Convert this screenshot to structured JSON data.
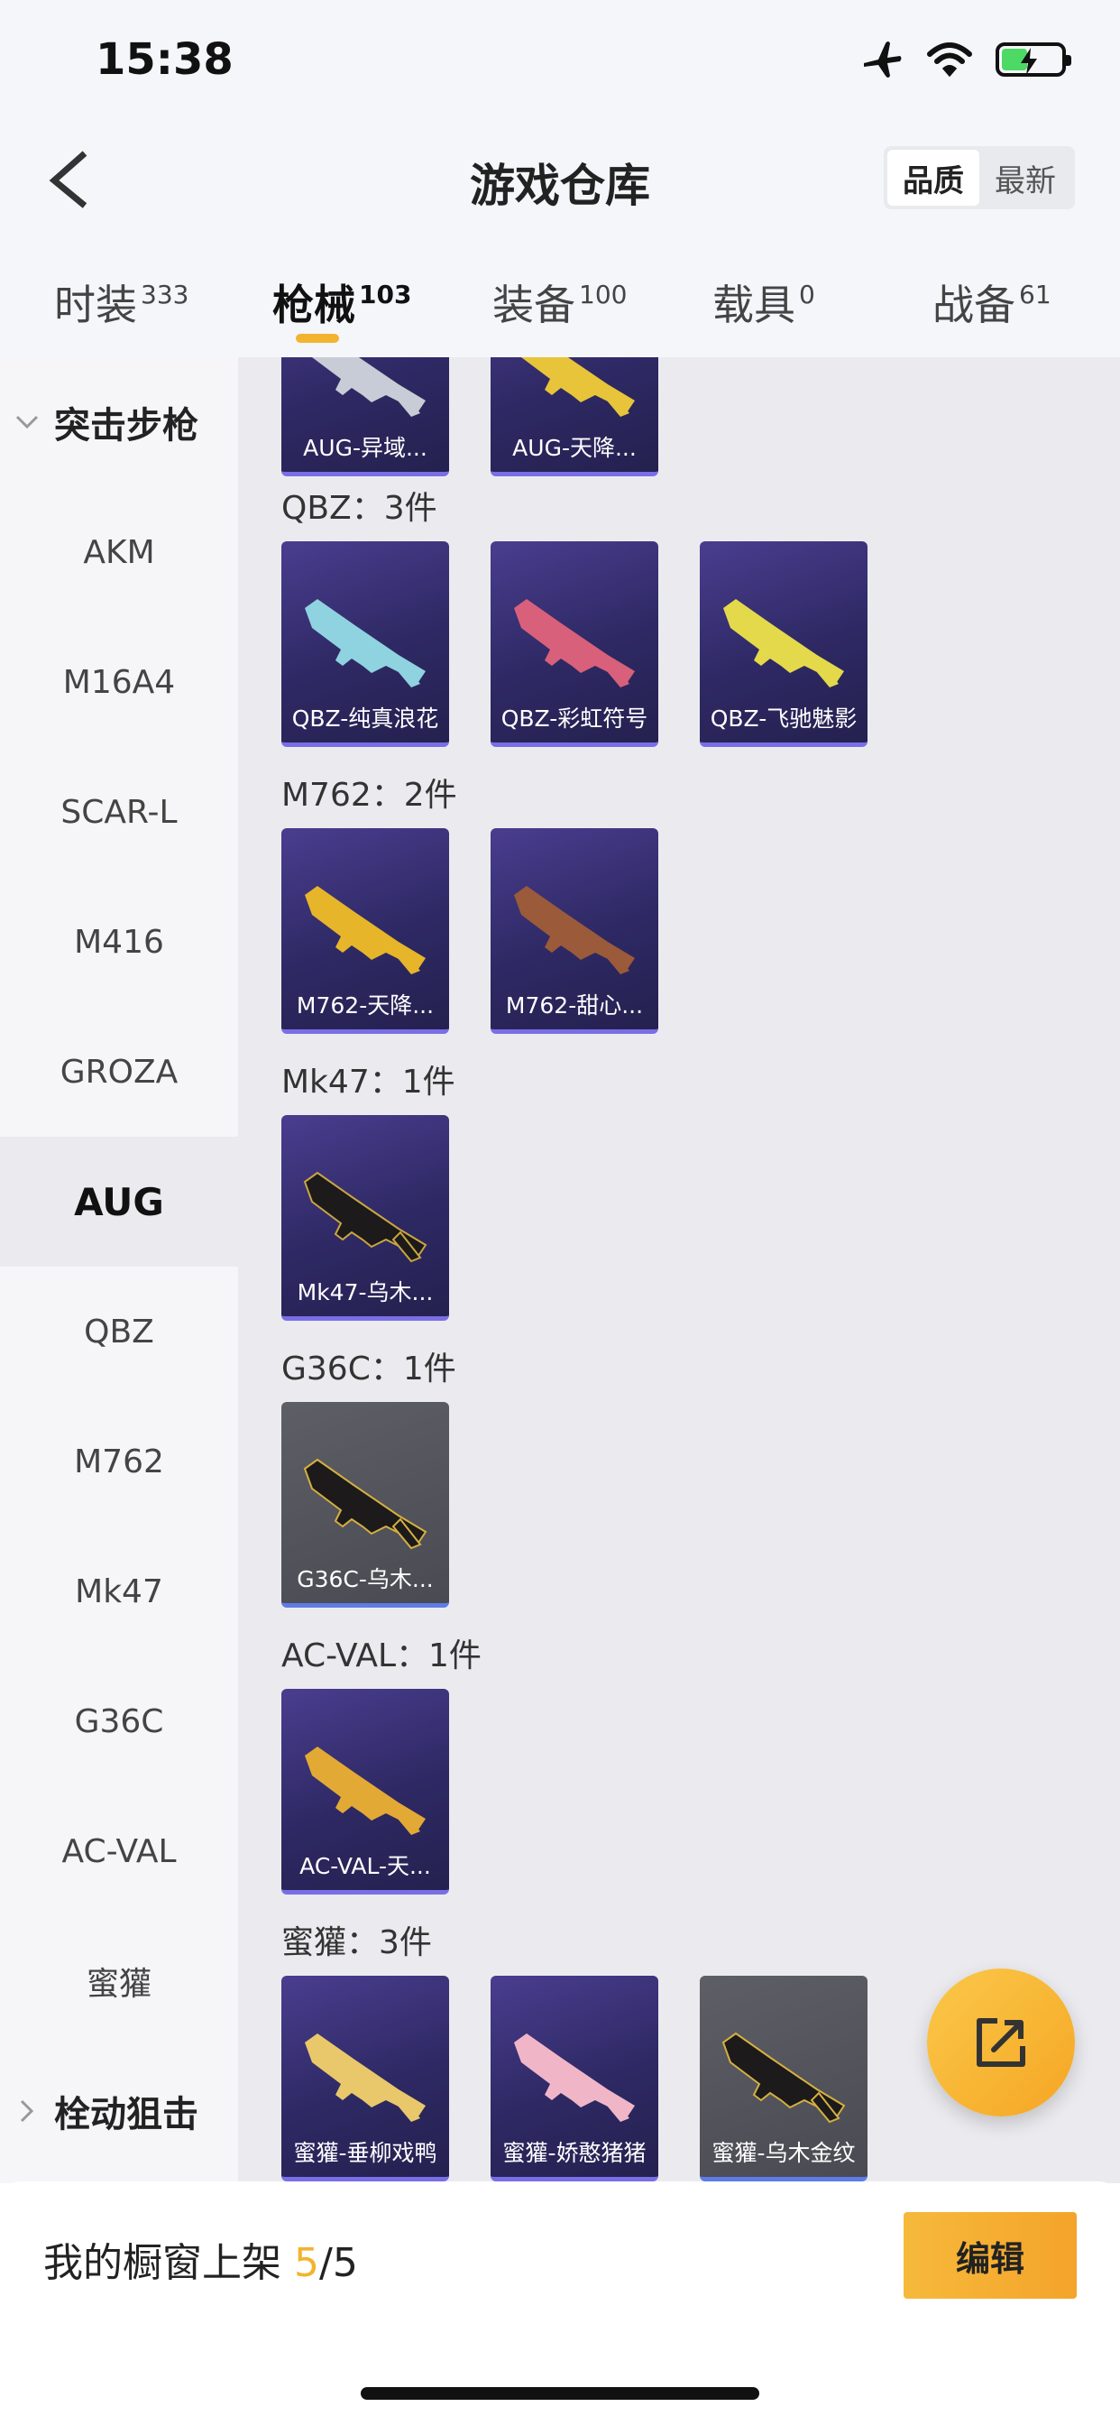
{
  "status_bar": {
    "time": "15:38"
  },
  "header": {
    "title": "游戏仓库",
    "sort_quality": "品质",
    "sort_newest": "最新"
  },
  "tabs": [
    {
      "label": "时装",
      "count": "333"
    },
    {
      "label": "枪械",
      "count": "103"
    },
    {
      "label": "装备",
      "count": "100"
    },
    {
      "label": "载具",
      "count": "0"
    },
    {
      "label": "战备",
      "count": "61"
    }
  ],
  "sidebar": {
    "category_1": "突击步枪",
    "items": [
      "AKM",
      "M16A4",
      "SCAR-L",
      "M416",
      "GROZA",
      "AUG",
      "QBZ",
      "M762",
      "Mk47",
      "G36C",
      "AC-VAL",
      "蜜獾"
    ],
    "category_2": "栓动狙击"
  },
  "groups": {
    "aug": {
      "cards": [
        "AUG-异域...",
        "AUG-天降..."
      ]
    },
    "qbz": {
      "title": "QBZ：3件",
      "cards": [
        "QBZ-纯真浪花",
        "QBZ-彩虹符号",
        "QBZ-飞驰魅影"
      ]
    },
    "m762": {
      "title": "M762：2件",
      "cards": [
        "M762-天降...",
        "M762-甜心..."
      ]
    },
    "mk47": {
      "title": "Mk47：1件",
      "cards": [
        "Mk47-乌木..."
      ]
    },
    "g36c": {
      "title": "G36C：1件",
      "cards": [
        "G36C-乌木..."
      ]
    },
    "acval": {
      "title": "AC-VAL：1件",
      "cards": [
        "AC-VAL-天..."
      ]
    },
    "honeybadger": {
      "title": "蜜獾：3件",
      "cards": [
        "蜜獾-垂柳戏鸭",
        "蜜獾-娇憨猪猪",
        "蜜獾-乌木金纹"
      ]
    }
  },
  "bottom": {
    "shelf_prefix": "我的橱窗上架 ",
    "shelf_count": "5",
    "shelf_total": "/5",
    "edit_label": "编辑"
  },
  "colors": {
    "accent": "#f2b42e",
    "card_purple": "#2e2964",
    "card_gray": "#4a4a52"
  }
}
